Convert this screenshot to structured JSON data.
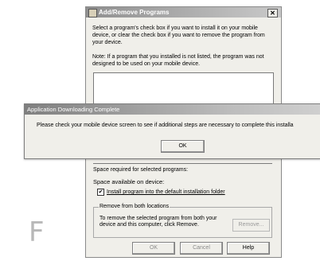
{
  "background_letter": "F",
  "add_remove": {
    "title": "Add/Remove Programs",
    "close_glyph": "✕",
    "instructions": "Select a program's check box if you want to install it on your mobile device, or clear the check box if you want to remove the program from your device.",
    "note": "Note:  If a program that you installed is not listed, the program was not designed to be used on your mobile device.",
    "space_required": "Space required for selected programs:",
    "space_available": "Space available on device:",
    "checkbox_label": "Install program into the default installation folder",
    "checkbox_checked": true,
    "group_title": "Remove from both locations",
    "group_text": "To remove the selected program from both your device and this computer, click Remove.",
    "remove_label": "Remove...",
    "ok_label": "OK",
    "cancel_label": "Cancel",
    "help_label": "Help"
  },
  "alert": {
    "title": "Application Downloading Complete",
    "message": "Please check your mobile device screen to see if additional steps are necessary to complete this installa",
    "ok_label": "OK"
  }
}
